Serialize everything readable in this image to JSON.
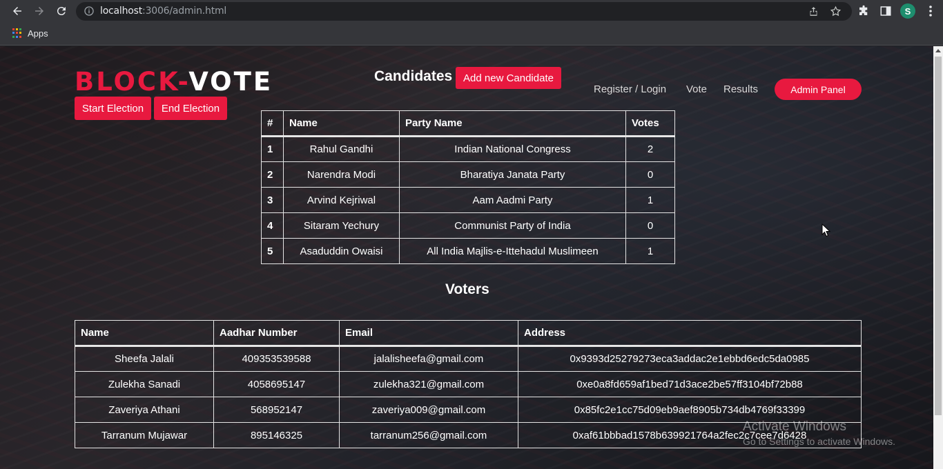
{
  "browser": {
    "url_host": "localhost",
    "url_rest": ":3006/admin.html",
    "profile_initial": "S",
    "bookmarks": {
      "apps_label": "Apps"
    },
    "icons": [
      "back-icon",
      "forward-icon",
      "reload-icon",
      "info-icon",
      "share-icon",
      "star-icon",
      "extensions-icon",
      "sidepanel-icon",
      "menu-icon"
    ]
  },
  "site": {
    "logo_red": "BLOCK-",
    "logo_white": "VOTE",
    "start_election": "Start Election",
    "end_election": "End Election",
    "nav": {
      "register": "Register / Login",
      "vote": "Vote",
      "results": "Results",
      "admin": "Admin Panel"
    },
    "accent_color": "#e8193f"
  },
  "candidates": {
    "title": "Candidates",
    "add_button": "Add new Candidate",
    "headers": [
      "#",
      "Name",
      "Party Name",
      "Votes"
    ],
    "rows": [
      {
        "id": "1",
        "name": "Rahul Gandhi",
        "party": "Indian National Congress",
        "votes": "2"
      },
      {
        "id": "2",
        "name": "Narendra Modi",
        "party": "Bharatiya Janata Party",
        "votes": "0"
      },
      {
        "id": "3",
        "name": "Arvind Kejriwal",
        "party": "Aam Aadmi Party",
        "votes": "1"
      },
      {
        "id": "4",
        "name": "Sitaram Yechury",
        "party": "Communist Party of India",
        "votes": "0"
      },
      {
        "id": "5",
        "name": "Asaduddin Owaisi",
        "party": "All India Majlis-e-Ittehadul Muslimeen",
        "votes": "1"
      }
    ]
  },
  "voters": {
    "title": "Voters",
    "headers": [
      "Name",
      "Aadhar Number",
      "Email",
      "Address"
    ],
    "rows": [
      {
        "name": "Sheefa Jalali",
        "aadhar": "409353539588",
        "email": "jalalisheefa@gmail.com",
        "address": "0x9393d25279273eca3addac2e1ebbd6edc5da0985"
      },
      {
        "name": "Zulekha Sanadi",
        "aadhar": "4058695147",
        "email": "zulekha321@gmail.com",
        "address": "0xe0a8fd659af1bed71d3ace2be57ff3104bf72b88"
      },
      {
        "name": "Zaveriya Athani",
        "aadhar": "568952147",
        "email": "zaveriya009@gmail.com",
        "address": "0x85fc2e1cc75d09eb9aef8905b734db4769f33399"
      },
      {
        "name": "Tarranum Mujawar",
        "aadhar": "895146325",
        "email": "tarranum256@gmail.com",
        "address": "0xaf61bbbad1578b639921764a2fec2c7cee7d6428"
      }
    ]
  },
  "os_overlay": {
    "line1": "Activate Windows",
    "line2": "Go to Settings to activate Windows."
  }
}
